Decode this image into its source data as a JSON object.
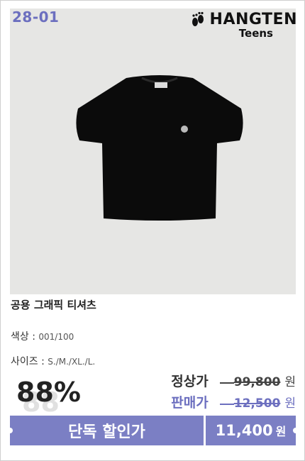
{
  "product": {
    "code": "28-01",
    "brand": {
      "name": "HANGTEN",
      "sub": "Teens",
      "logo_icon": "footprint-icon"
    },
    "image": {
      "subject": "black-tshirt",
      "background": "#e6e6e4"
    },
    "title": "공용 그래픽 티셔츠",
    "color_label": "색상 :",
    "color_value": "001/100",
    "size_label": "사이즈 :",
    "size_value": "S./M./XL./L.",
    "discount": "88%",
    "regular_label": "정상가",
    "regular_price": "99,800",
    "sale_label": "판매가",
    "sale_price": "12,500",
    "won": "원",
    "exclusive_label": "단독 할인가",
    "exclusive_price": "11,400",
    "accent": "#7b7fc4"
  }
}
